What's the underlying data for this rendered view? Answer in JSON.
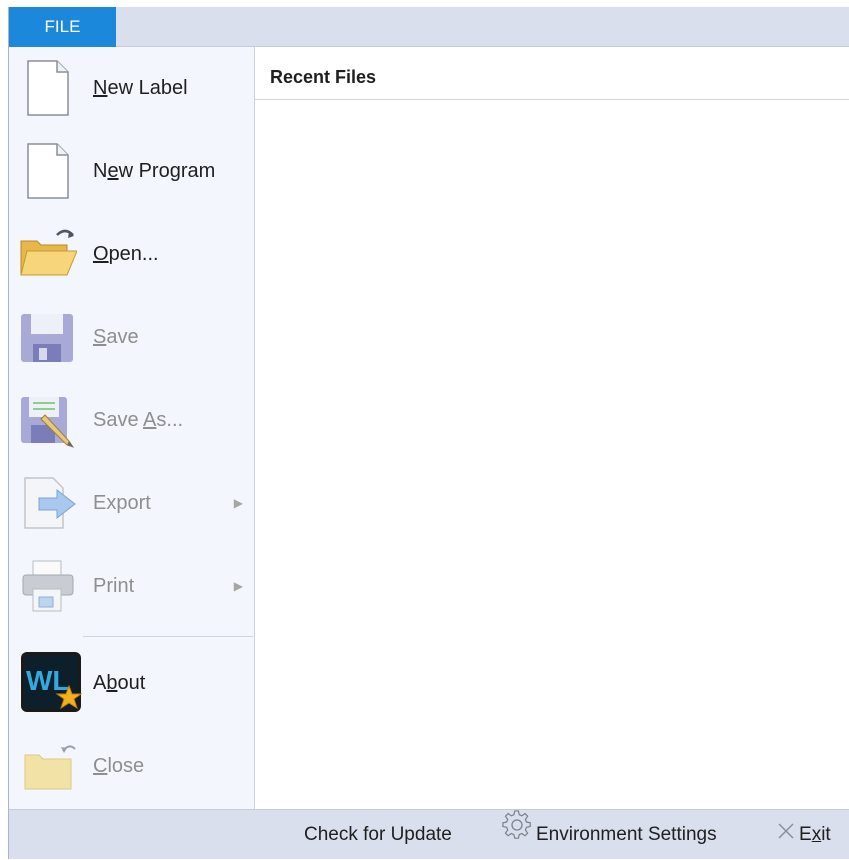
{
  "file_tab": {
    "label": "FILE"
  },
  "menu": {
    "items": [
      {
        "id": "new-label",
        "label": "New Label",
        "mnemonic_index": 0,
        "enabled": true,
        "submenu": false,
        "icon": "new-document-icon"
      },
      {
        "id": "new-program",
        "label": "New Program",
        "mnemonic_index": 1,
        "enabled": true,
        "submenu": false,
        "icon": "new-document-icon"
      },
      {
        "id": "open",
        "label": "Open...",
        "mnemonic_index": 0,
        "enabled": true,
        "submenu": false,
        "icon": "open-folder-icon"
      },
      {
        "id": "save",
        "label": "Save",
        "mnemonic_index": 0,
        "enabled": false,
        "submenu": false,
        "icon": "floppy-disk-icon"
      },
      {
        "id": "save-as",
        "label": "Save As...",
        "mnemonic_index": 5,
        "enabled": false,
        "submenu": false,
        "icon": "save-as-icon"
      },
      {
        "id": "export",
        "label": "Export",
        "mnemonic_index": -1,
        "enabled": false,
        "submenu": true,
        "icon": "export-icon"
      },
      {
        "id": "print",
        "label": "Print",
        "mnemonic_index": -1,
        "enabled": false,
        "submenu": true,
        "icon": "printer-icon"
      },
      {
        "id": "about",
        "label": "About",
        "mnemonic_index": 1,
        "enabled": true,
        "submenu": false,
        "icon": "wl-star-logo-icon"
      },
      {
        "id": "close",
        "label": "Close",
        "mnemonic_index": 0,
        "enabled": false,
        "submenu": false,
        "icon": "close-folder-icon"
      }
    ]
  },
  "recent": {
    "title": "Recent Files"
  },
  "bottom_bar": {
    "check_update": "Check for Update",
    "environment_settings": "Environment Settings",
    "exit": "Exit"
  },
  "colors": {
    "accent": "#1b88db",
    "bar_background": "#d9dfec",
    "panel_background": "#f3f6fd",
    "disabled_text": "#8e8e8e"
  }
}
